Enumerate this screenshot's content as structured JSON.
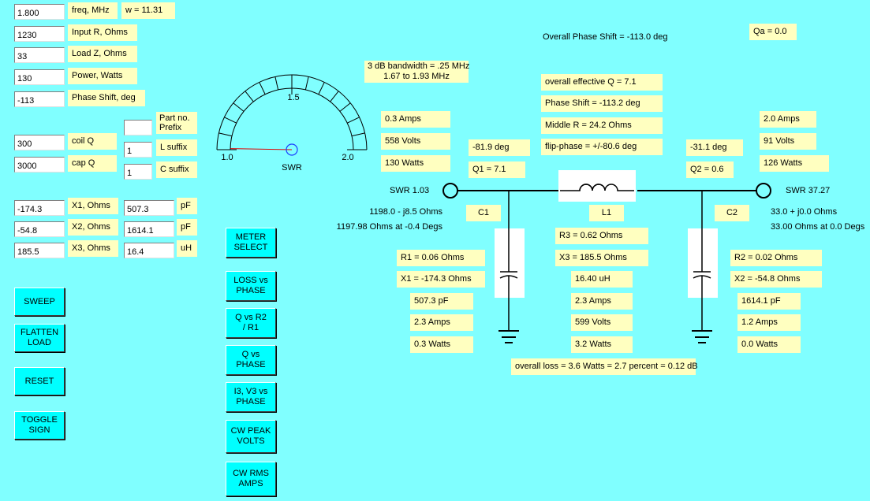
{
  "inputs": {
    "freq": {
      "value": "1.800",
      "label": "freq, MHz"
    },
    "input_r": {
      "value": "1230",
      "label": "Input R, Ohms"
    },
    "load_z": {
      "value": "33",
      "label": "Load Z, Ohms"
    },
    "power": {
      "value": "130",
      "label": "Power, Watts"
    },
    "phase_shift": {
      "value": "-113",
      "label": "Phase Shift, deg"
    },
    "coil_q": {
      "value": "300",
      "label": "coil  Q"
    },
    "cap_q": {
      "value": "3000",
      "label": "cap  Q"
    },
    "part_prefix": {
      "value": "",
      "label": "Part no.\nPrefix"
    },
    "l_suffix": {
      "value": "1",
      "label": "L suffix"
    },
    "c_suffix": {
      "value": "1",
      "label": "C suffix"
    }
  },
  "omega": "w = 11.31",
  "reactances": [
    {
      "x_value": "-174.3",
      "x_label": "X1, Ohms",
      "c_value": "507.3",
      "unit": "pF"
    },
    {
      "x_value": "-54.8",
      "x_label": "X2, Ohms",
      "c_value": "1614.1",
      "unit": "pF"
    },
    {
      "x_value": "185.5",
      "x_label": "X3, Ohms",
      "c_value": "16.4",
      "unit": "uH"
    }
  ],
  "buttons_left": {
    "sweep": "SWEEP",
    "flatten": "FLATTEN\nLOAD",
    "reset": "RESET",
    "toggle": "TOGGLE\nSIGN"
  },
  "buttons_mid": {
    "meter": "METER\nSELECT",
    "loss_phase": "LOSS vs\nPHASE",
    "q_r2r1": "Q vs    R2\n/ R1",
    "q_phase": "Q vs\nPHASE",
    "i3v3": "I3, V3 vs\nPHASE",
    "cw_peak": "CW PEAK\nVOLTS",
    "cw_rms": "CW RMS\nAMPS"
  },
  "meter": {
    "label": "SWR",
    "tick_min": "1.0",
    "tick_mid": "1.5",
    "tick_max": "2.0",
    "swr_value": 1.03
  },
  "header": {
    "overall_phase": "Overall Phase Shift = -113.0 deg",
    "qa": "Qa = 0.0",
    "bandwidth_line1": "3 dB bandwidth = .25 MHz",
    "bandwidth_line2": "1.67 to 1.93 MHz"
  },
  "middle_info": {
    "eff_q": "overall effective Q = 7.1",
    "phase": "Phase Shift = -113.2 deg",
    "middle_r": "Middle R = 24.2 Ohms",
    "flip": "flip-phase = +/-80.6 deg"
  },
  "input_side": {
    "amps": "0.3 Amps",
    "volts": "558 Volts",
    "watts": "130 Watts",
    "phase": "-81.9 deg",
    "q1": "Q1 = 7.1",
    "swr": "SWR 1.03",
    "z1": "1198.0 - j8.5 Ohms",
    "z2": "1197.98 Ohms at -0.4 Degs"
  },
  "output_side": {
    "amps": "2.0 Amps",
    "volts": "91 Volts",
    "watts": "126 Watts",
    "phase": "-31.1 deg",
    "q2": "Q2 = 0.6",
    "swr": "SWR 37.27",
    "z1": "33.0 + j0.0 Ohms",
    "z2": "33.00 Ohms at 0.0 Degs"
  },
  "c1": {
    "name": "C1",
    "r": "R1 = 0.06 Ohms",
    "x": "X1 = -174.3 Ohms",
    "cap": "507.3 pF",
    "amps": "2.3 Amps",
    "watts": "0.3 Watts"
  },
  "l1": {
    "name": "L1",
    "r": "R3 = 0.62 Ohms",
    "x": "X3 = 185.5 Ohms",
    "ind": "16.40 uH",
    "amps": "2.3 Amps",
    "volts": "599 Volts",
    "watts": "3.2 Watts"
  },
  "c2": {
    "name": "C2",
    "r": "R2 = 0.02 Ohms",
    "x": "X2 = -54.8 Ohms",
    "cap": "1614.1 pF",
    "amps": "1.2 Amps",
    "watts": "0.0 Watts"
  },
  "overall_loss": "overall loss = 3.6 Watts = 2.7 percent = 0.12 dB"
}
